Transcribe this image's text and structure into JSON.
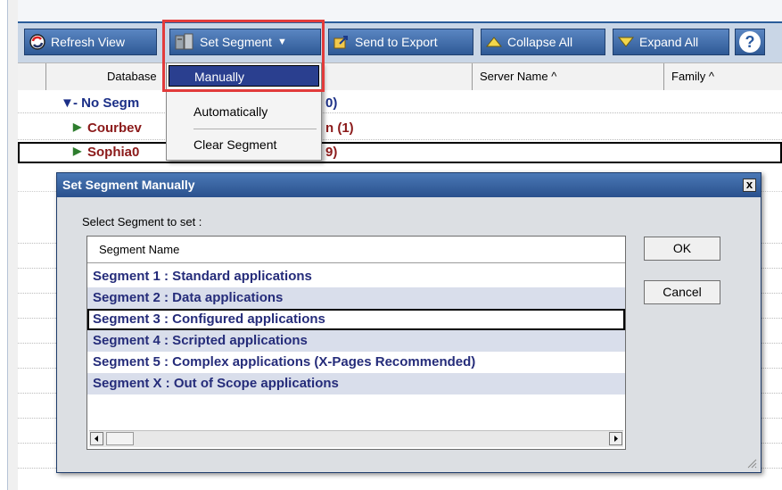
{
  "toolbar": {
    "refresh_label": "Refresh View",
    "set_segment_label": "Set Segment",
    "send_export_label": "Send to Export",
    "collapse_label": "Collapse All",
    "expand_label": "Expand All",
    "help_icon": "question-mark-icon"
  },
  "columns": {
    "database": "Database",
    "server_name": "Server Name ^",
    "family": "Family ^"
  },
  "tree": {
    "group_label": "- No Segm",
    "group_count_fragment": "0)",
    "child1_label": "Courbev",
    "child1_count_fragment": "n  (1)",
    "child2_label": "Sophia0",
    "child2_count_fragment": "9)"
  },
  "menu": {
    "items": [
      "Manually",
      "Automatically",
      "Clear Segment"
    ]
  },
  "dialog": {
    "title": "Set Segment Manually",
    "close_label": "x",
    "prompt": "Select Segment to set :",
    "column_header": "Segment Name",
    "segments": [
      "Segment 1 : Standard applications",
      "Segment 2 : Data applications",
      "Segment 3 : Configured applications",
      "Segment 4 : Scripted applications",
      "Segment 5 : Complex applications (X-Pages Recommended)",
      "Segment X : Out of Scope applications"
    ],
    "ok_label": "OK",
    "cancel_label": "Cancel"
  },
  "colors": {
    "toolbar_button": "#3f6eaa",
    "highlight_border": "#e23b3b",
    "segment_text": "#252c7a",
    "tree_group": "#1b2f87",
    "tree_child": "#8b1a1a"
  }
}
